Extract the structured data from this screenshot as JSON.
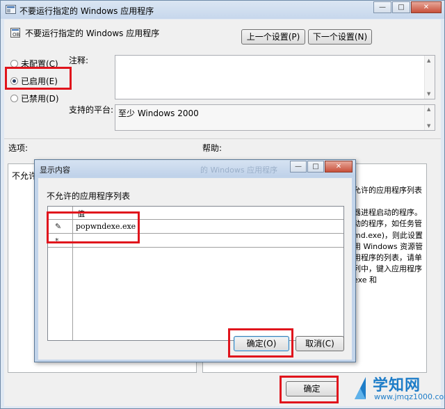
{
  "window": {
    "title": "不要运行指定的 Windows 应用程序",
    "caption": {
      "minimize": "—",
      "maximize": "□",
      "close": "✕"
    }
  },
  "policy": {
    "heading": "不要运行指定的 Windows 应用程序",
    "prev_label": "上一个设置(P)",
    "next_label": "下一个设置(N)"
  },
  "state": {
    "not_configured": "未配置(C)",
    "enabled": "已启用(E)",
    "disabled": "已禁用(D)",
    "selected": "enabled"
  },
  "comment": {
    "label": "注释:",
    "value": ""
  },
  "platform": {
    "label": "支持的平台:",
    "value": "至少 Windows 2000"
  },
  "sections": {
    "options": "选项:",
    "help": "帮助:"
  },
  "options_panel": {
    "text": "不允许的"
  },
  "help_panel": {
    "lines": [
      "允许的应用程序列表",
      "",
      "器进程启动的程序。",
      "动的程序，如任务管",
      "md.exe)，则此设置",
      "用 Windows 资源管",
      "用程序的列表，请单",
      "列中，键入应用程序",
      "exe 和"
    ]
  },
  "footer": {
    "ok_label": "确定"
  },
  "modal": {
    "title": "显示内容",
    "ghost_title": "的 Windows 应用程序",
    "list_label": "不允许的应用程序列表",
    "column_header": "值",
    "rows": [
      {
        "glyph": "✎",
        "value": "popwndexe.exe"
      },
      {
        "glyph": "*",
        "value": ""
      }
    ],
    "ok_label": "确定(O)",
    "cancel_label": "取消(C)"
  },
  "watermark": {
    "name": "学知网",
    "url": "www.jmqz1000.com"
  },
  "colors": {
    "highlight": "#e0141c",
    "accent": "#1e7dc8"
  }
}
